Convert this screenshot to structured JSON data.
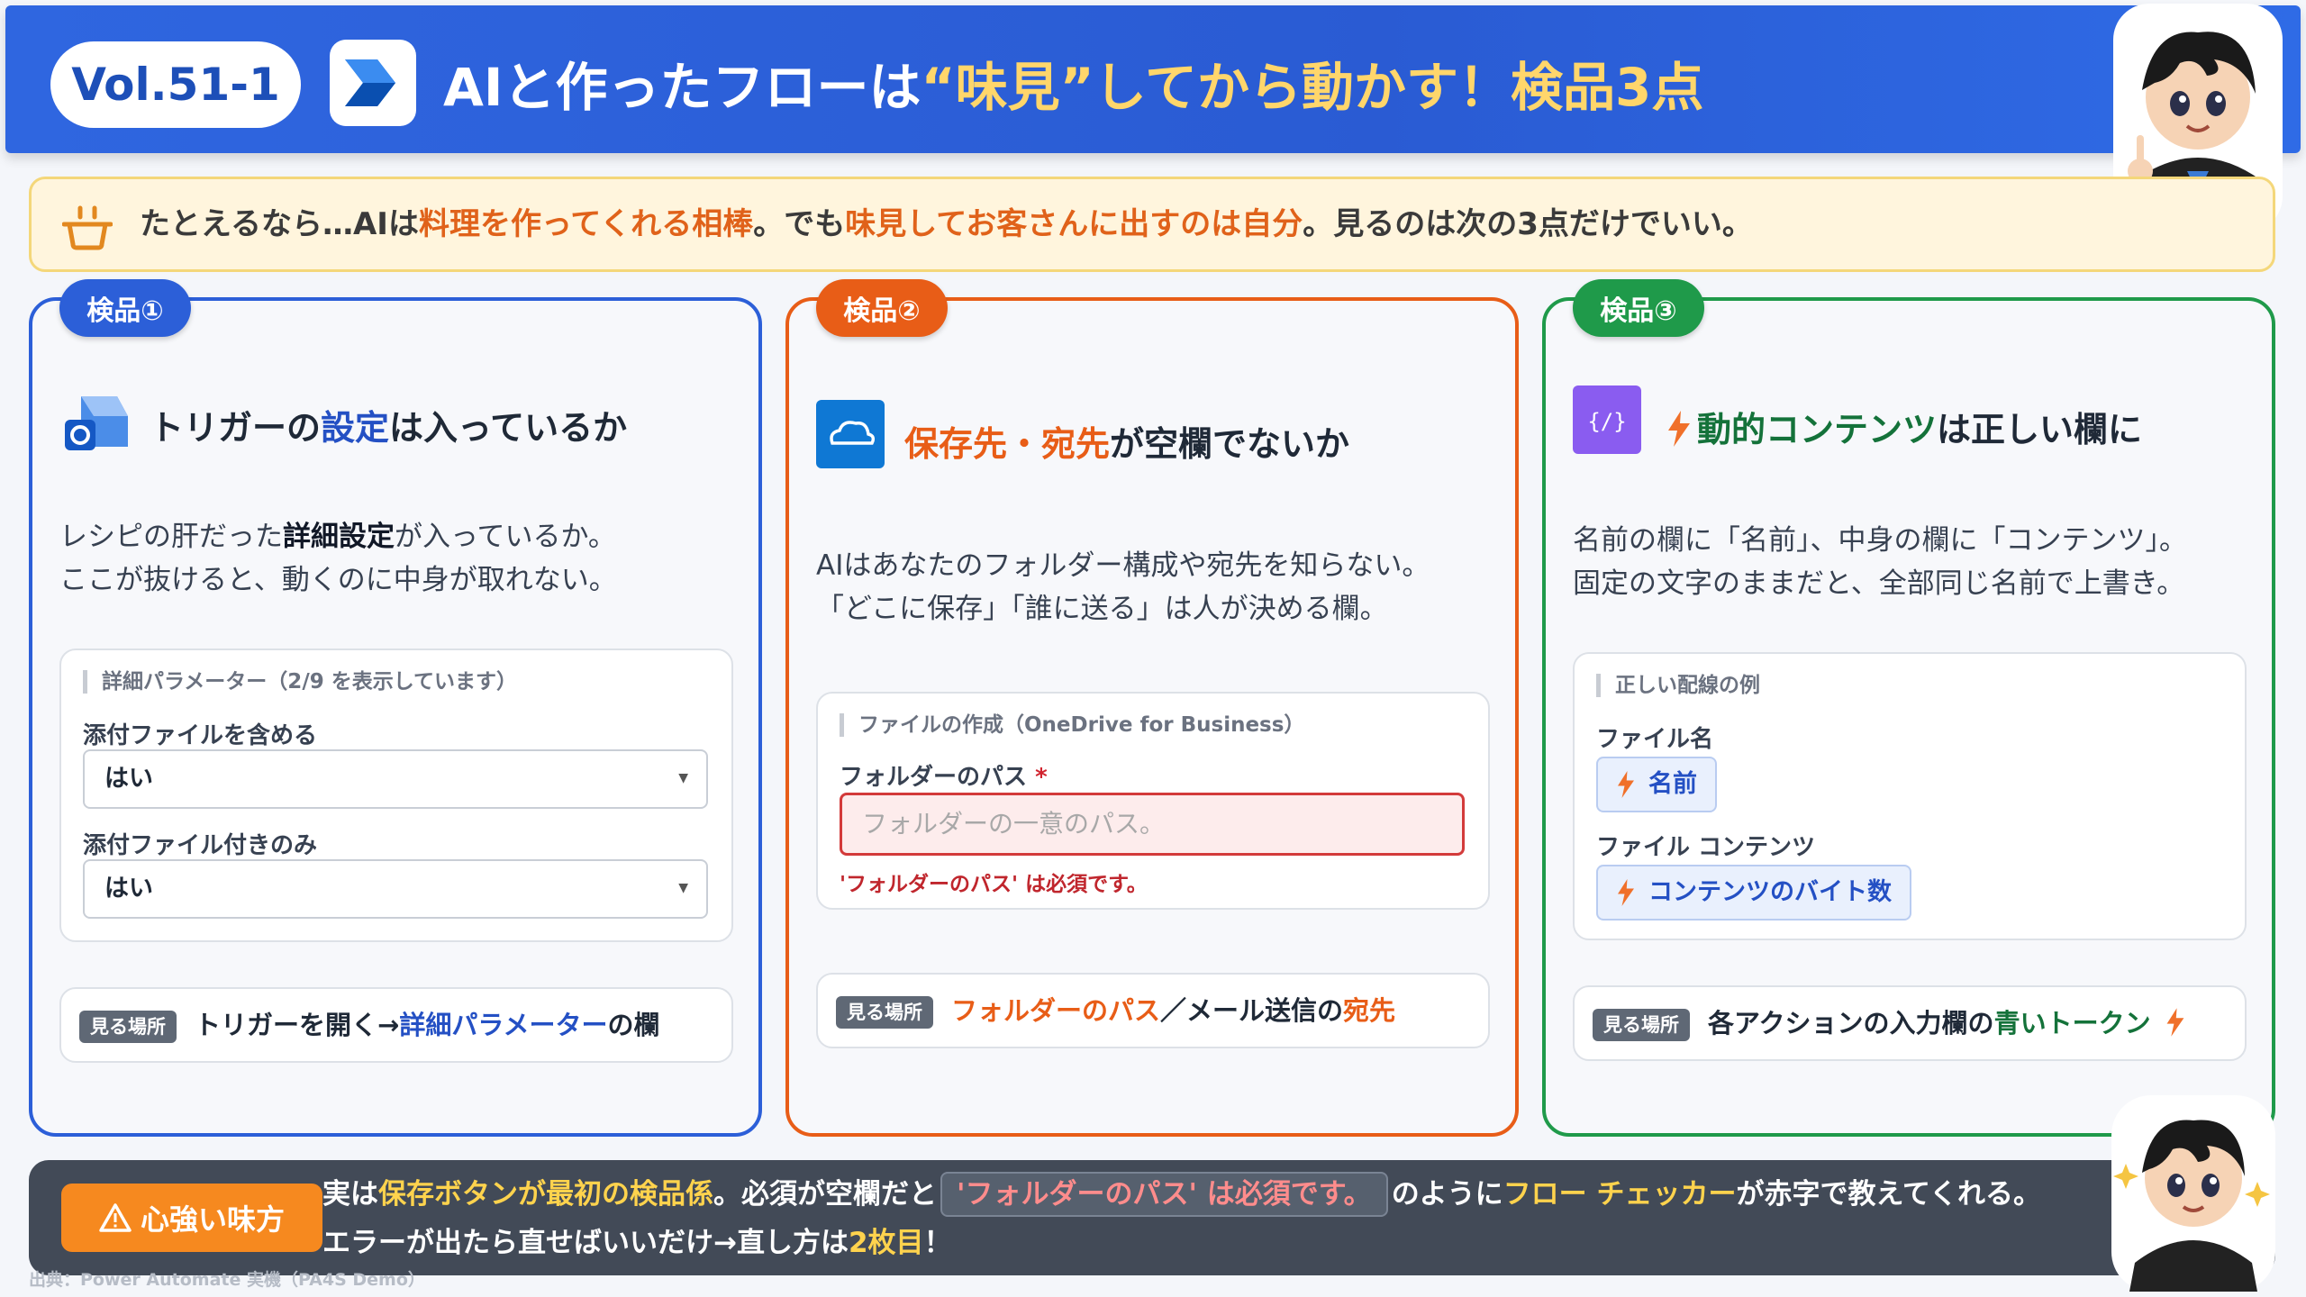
{
  "header": {
    "vol": "Vol.51-1",
    "title_part1": "AIと作ったフローは",
    "title_hl": "“味見”",
    "title_part2": "してから動かす！検品3点"
  },
  "banner": {
    "t1": "たとえるなら…AIは",
    "t2": "料理を作ってくれる相棒",
    "t3": "。でも",
    "t4": "味見してお客さんに出すのは自分",
    "t5": "。見るのは次の3点だけでいい。"
  },
  "cards": [
    {
      "badge": "検品①",
      "title_a": "トリガーの",
      "title_b": "設定",
      "title_c": "は入っているか",
      "desc1_a": "レシピの肝だった",
      "desc1_b": "詳細設定",
      "desc1_c": "が入っているか。",
      "desc2": "ここが抜けると、動くのに中身が取れない。",
      "panel_head": "詳細パラメーター（2/9 を表示しています）",
      "field1_label": "添付ファイルを含める",
      "field1_value": "はい",
      "field2_label": "添付ファイル付きのみ",
      "field2_value": "はい",
      "where_badge": "見る場所",
      "where_a": "トリガーを開く→",
      "where_b": "詳細パラメーター",
      "where_c": "の欄"
    },
    {
      "badge": "検品②",
      "title_a": "保存先・宛先",
      "title_b": "が空欄でないか",
      "desc1": "AIはあなたのフォルダー構成や宛先を知らない。",
      "desc2": "「どこに保存」「誰に送る」は人が決める欄。",
      "panel_head": "ファイルの作成（OneDrive for Business）",
      "field_label": "フォルダーのパス",
      "required_mark": "*",
      "placeholder": "フォルダーの一意のパス。",
      "error": "'フォルダーのパス' は必須です。",
      "where_badge": "見る場所",
      "where_a": "フォルダーのパス",
      "where_b": "／メール送信の",
      "where_c": "宛先"
    },
    {
      "badge": "検品③",
      "title_a": "動的コンテンツ",
      "title_b": "は正しい欄に",
      "desc1": "名前の欄に「名前」、中身の欄に「コンテンツ」。",
      "desc2": "固定の文字のままだと、全部同じ名前で上書き。",
      "panel_head": "正しい配線の例",
      "field1_label": "ファイル名",
      "token1": "名前",
      "field2_label": "ファイル コンテンツ",
      "token2": "コンテンツのバイト数",
      "where_badge": "見る場所",
      "where_a": "各アクションの入力欄の",
      "where_b": "青いトークン"
    }
  ],
  "bottom": {
    "button": "心強い味方",
    "l1_a": "実は",
    "l1_b": "保存ボタンが最初の検品係",
    "l1_c": "。必須が空欄だと",
    "l1_chip": "'フォルダーのパス' は必須です。",
    "l1_d": "のように",
    "l1_e": "フロー チェッカー",
    "l1_f": "が赤字で教えてくれる。",
    "l2_a": "エラーが出たら直せばいいだけ→直し方は",
    "l2_b": "2枚目",
    "l2_c": "！"
  },
  "source": "出典：Power Automate 実機（PA4S Demo）",
  "icons": [
    "power-automate-logo",
    "pot-icon",
    "outlook-icon",
    "onedrive-icon",
    "expression-icon",
    "bolt-icon",
    "warning-icon",
    "character-illustration"
  ],
  "colors": {
    "blue": "#2c5fd8",
    "orange": "#e85d17",
    "green": "#1f9a4a",
    "banner": "#fff5dd"
  }
}
